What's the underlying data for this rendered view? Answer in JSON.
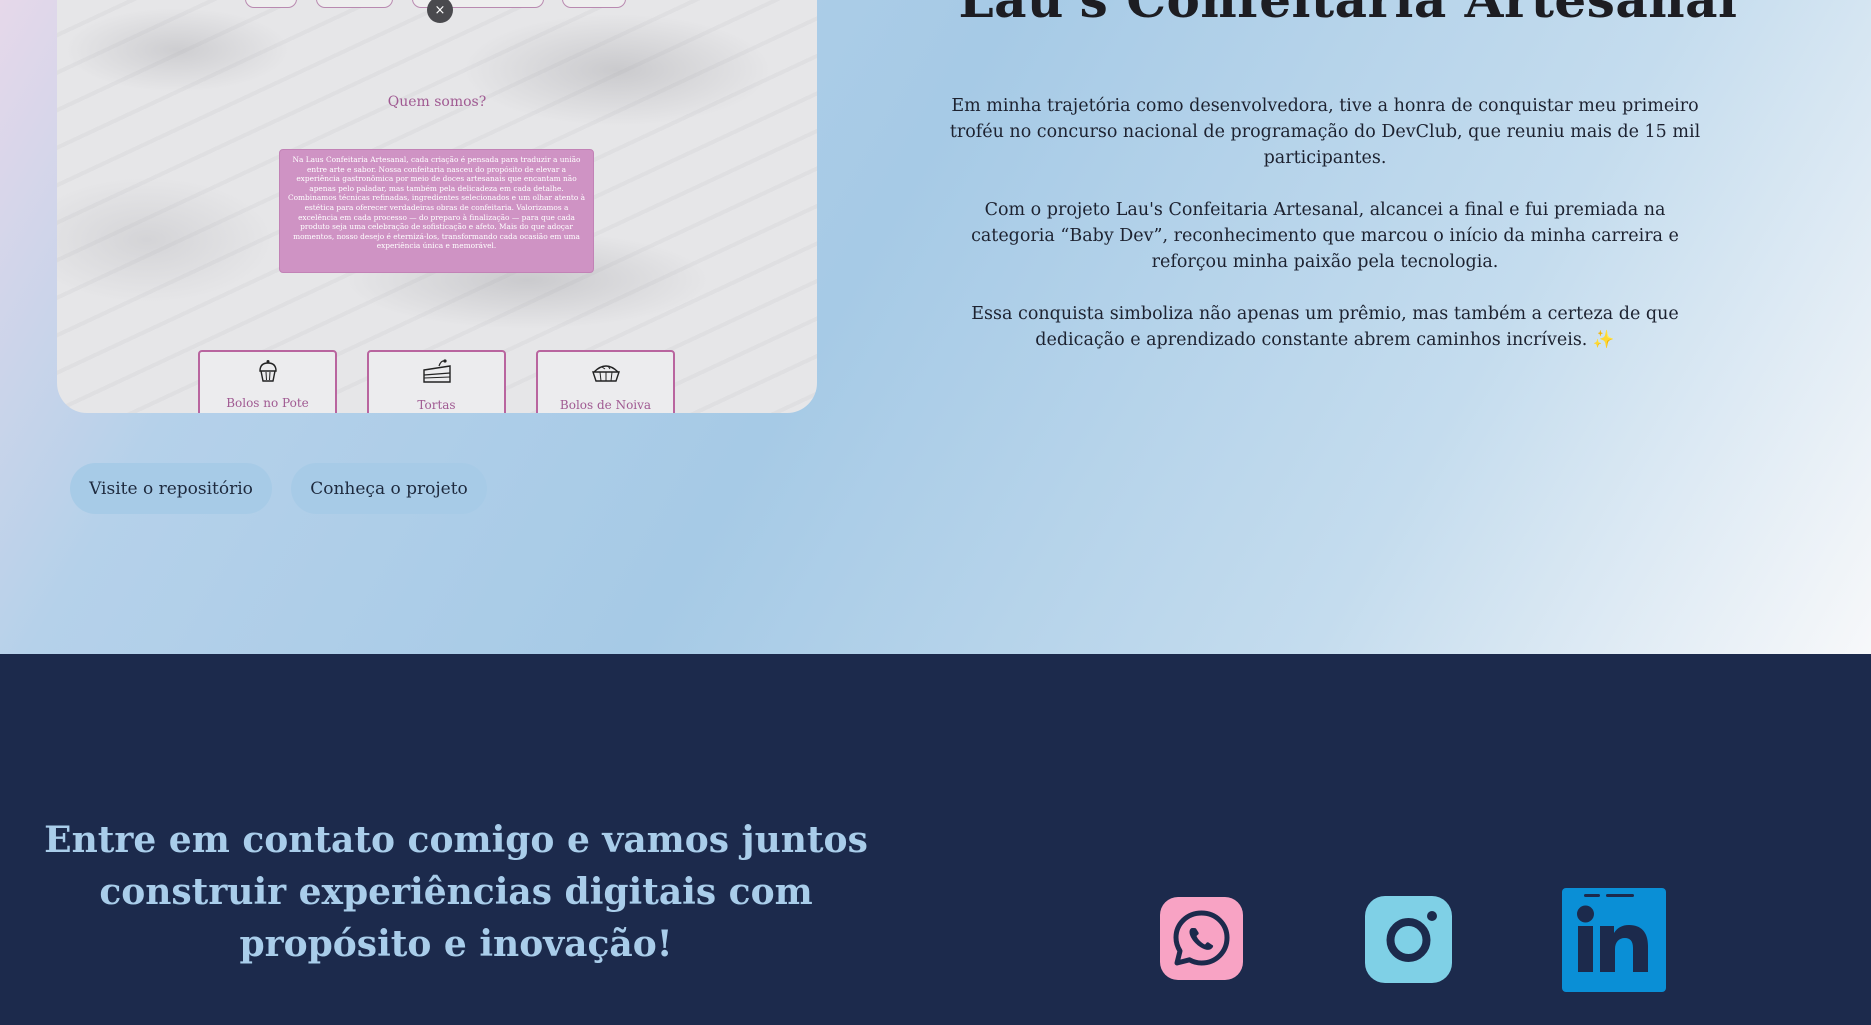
{
  "preview": {
    "close_glyph": "×",
    "section_heading": "Quem somos?",
    "about_text": "Na Laus Confeitaria Artesanal, cada criação é pensada para traduzir a união entre arte e sabor. Nossa confeitaria nasceu do propósito de elevar a experiência gastronômica por meio de doces artesanais que encantam não apenas pelo paladar, mas também pela delicadeza em cada detalhe. Combinamos técnicas refinadas, ingredientes selecionados e um olhar atento à estética para oferecer verdadeiras obras de confeitaria. Valorizamos a excelência em cada processo — do preparo à finalização — para que cada produto seja uma celebração de sofisticação e afeto. Mais do que adoçar momentos, nosso desejo é eternizá-los, transformando cada ocasião em uma experiência única e memorável.",
    "categories": [
      {
        "label": "Bolos no Pote",
        "icon": "cupcake-icon"
      },
      {
        "label": "Tortas",
        "icon": "cake-slice-icon"
      },
      {
        "label": "Bolos de Noiva",
        "icon": "pie-icon"
      }
    ]
  },
  "buttons": {
    "repo_label": "Visite o repositório",
    "project_label": "Conheça o projeto"
  },
  "project": {
    "title": "Lau's Confeitaria Artesanal",
    "paragraphs": [
      "Em minha trajetória como desenvolvedora, tive a honra de conquistar meu primeiro troféu no concurso nacional de programação do DevClub, que reuniu mais de 15 mil participantes.",
      "Com o projeto Lau's Confeitaria Artesanal, alcancei a final e fui premiada na categoria “Baby Dev”, reconhecimento que marcou o início da minha carreira e reforçou minha paixão pela tecnologia.",
      "Essa conquista simboliza não apenas um prêmio, mas também a certeza de que dedicação e aprendizado constante abrem caminhos incríveis. ✨"
    ]
  },
  "footer": {
    "contact_text": "Entre em contato comigo e vamos juntos construir experiências digitais com propósito e inovação!",
    "social": [
      {
        "name": "whatsapp-icon",
        "color": "#f8a3c4"
      },
      {
        "name": "instagram-icon",
        "color": "#7fd0e6"
      },
      {
        "name": "linkedin-icon",
        "color": "#0a8fd6"
      }
    ]
  },
  "colors": {
    "footer_bg": "#1c2a4c",
    "button_bg": "#a7cbe7",
    "contact_text": "#a9cdea",
    "about_box": "#cf93c4"
  }
}
